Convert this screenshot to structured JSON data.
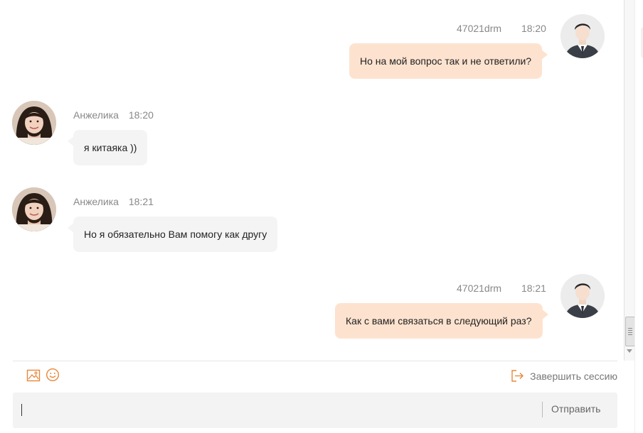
{
  "messages": [
    {
      "sender": "47021drm",
      "time": "18:20",
      "text": "Но на мой вопрос так и не ответили?",
      "direction": "outgoing"
    },
    {
      "sender": "Анжелика",
      "time": "18:20",
      "text": "я китаяка ))",
      "direction": "incoming"
    },
    {
      "sender": "Анжелика",
      "time": "18:21",
      "text": "Но я обязательно Вам помогу как другу",
      "direction": "incoming"
    },
    {
      "sender": "47021drm",
      "time": "18:21",
      "text": "Как с вами связаться в следующий раз?",
      "direction": "outgoing"
    }
  ],
  "toolbar": {
    "image_icon": "image-icon",
    "emoji_icon": "emoji-icon",
    "end_session_label": "Завершить сессию",
    "end_session_icon": "exit-icon"
  },
  "input": {
    "value": "",
    "send_label": "Отправить"
  },
  "colors": {
    "outgoing_bubble": "#fde3cf",
    "incoming_bubble": "#f4f4f4",
    "accent": "#e8873a"
  }
}
